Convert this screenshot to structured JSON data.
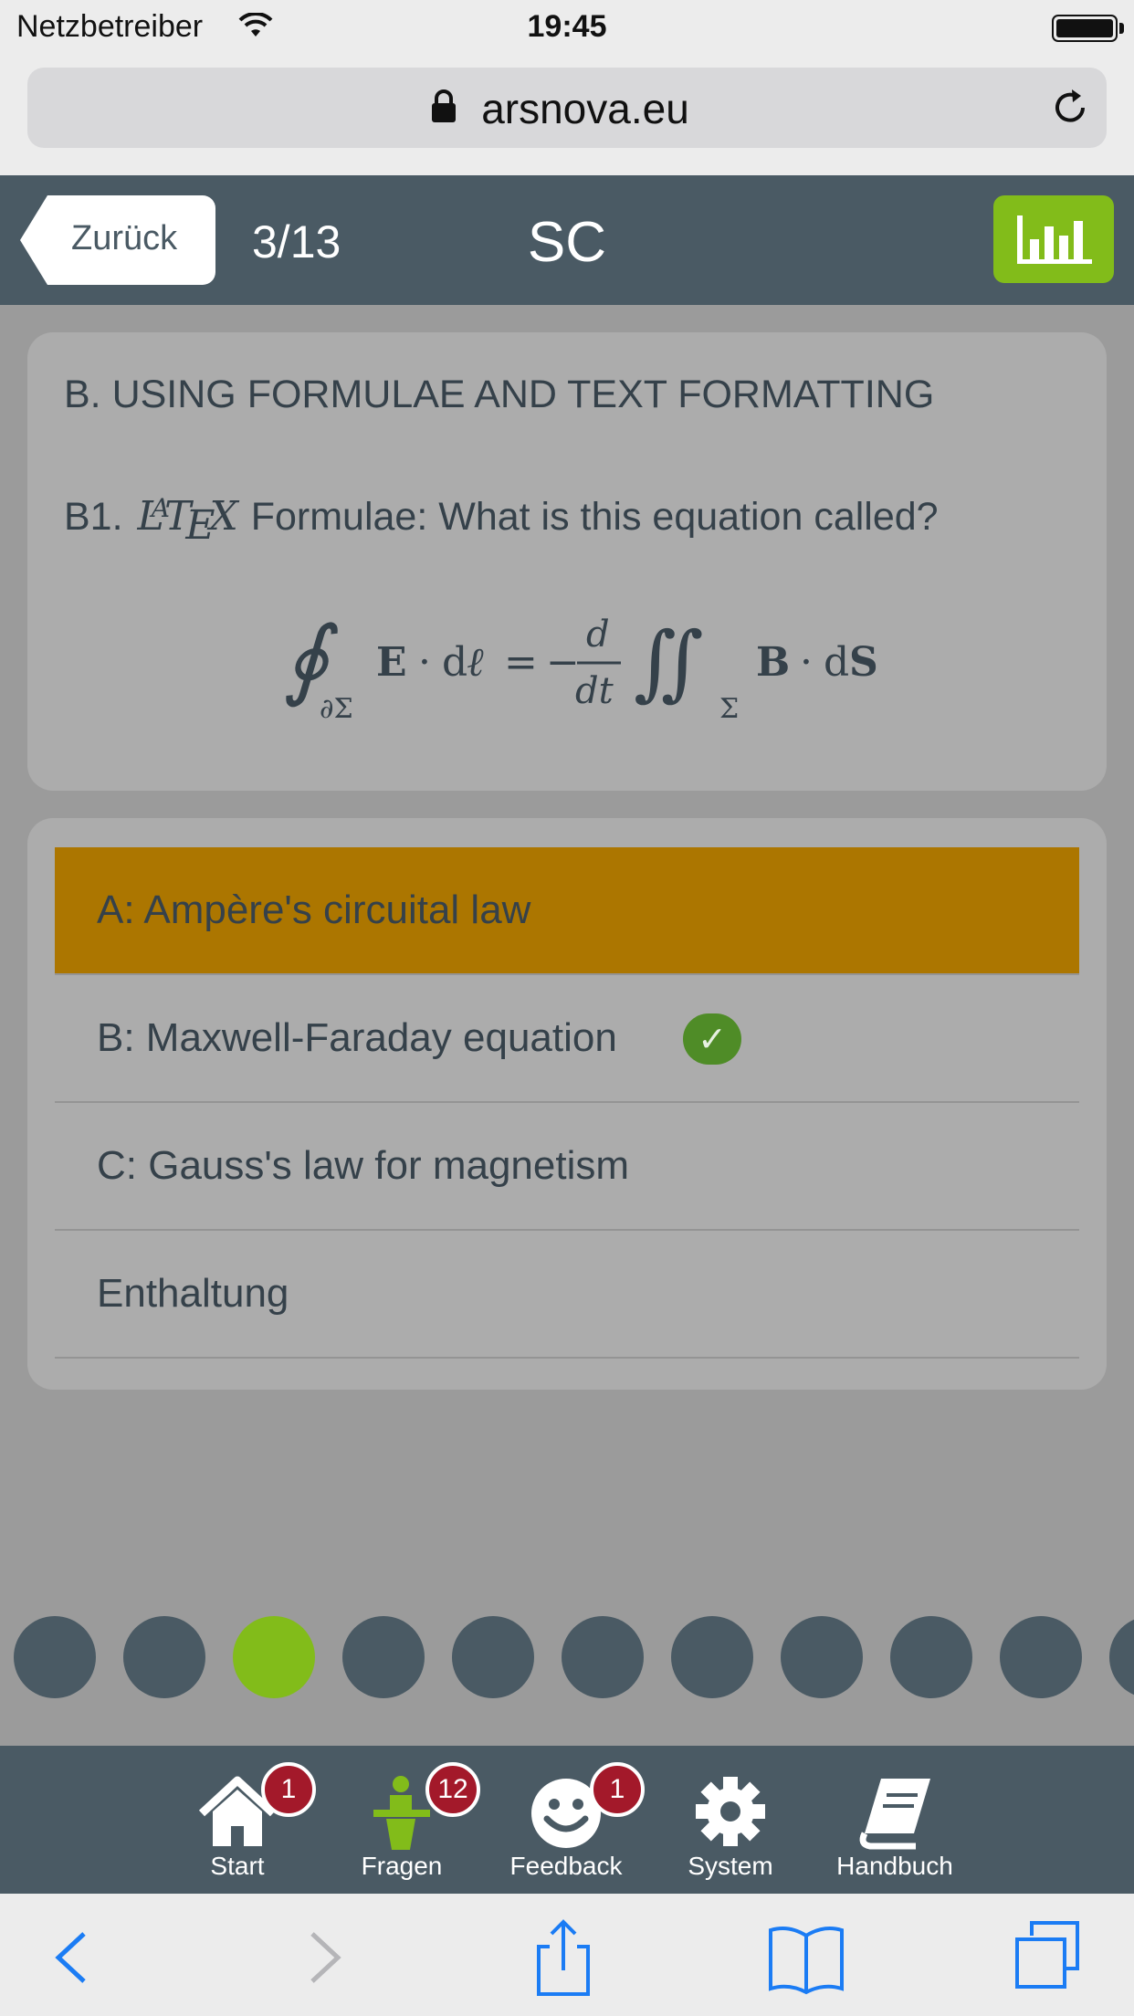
{
  "status_bar": {
    "carrier": "Netzbetreiber",
    "time": "19:45"
  },
  "browser": {
    "url": "arsnova.eu"
  },
  "header": {
    "back_label": "Zurück",
    "counter": "3/13",
    "question_type": "SC"
  },
  "question": {
    "title": "B. USING FORMULAE AND TEXT FORMATTING",
    "prefix": "B1.",
    "latex_logo": "LATEX",
    "text": "Formulae: What is this equation called?"
  },
  "answers": [
    {
      "label": "A: Ampère's circuital law",
      "selected": true,
      "correct": false
    },
    {
      "label": "B: Maxwell-Faraday equation",
      "selected": false,
      "correct": true
    },
    {
      "label": "C: Gauss's law for magnetism",
      "selected": false,
      "correct": false
    },
    {
      "label": "Enthaltung",
      "selected": false,
      "correct": false
    }
  ],
  "pagination": {
    "current": 3,
    "total": 13
  },
  "tabs": [
    {
      "label": "Start",
      "icon": "home-icon",
      "badge": "1"
    },
    {
      "label": "Fragen",
      "icon": "presenter-icon",
      "badge": "12"
    },
    {
      "label": "Feedback",
      "icon": "smiley-icon",
      "badge": "1"
    },
    {
      "label": "System",
      "icon": "gear-icon",
      "badge": ""
    },
    {
      "label": "Handbuch",
      "icon": "book-icon",
      "badge": ""
    }
  ],
  "colors": {
    "accent_green": "#82bc1a",
    "header_bg": "#4a5a64",
    "selected_answer": "#ac7600",
    "correct_check": "#4f8c27",
    "badge": "#a3192a",
    "safari_blue": "#1b7cf4"
  }
}
